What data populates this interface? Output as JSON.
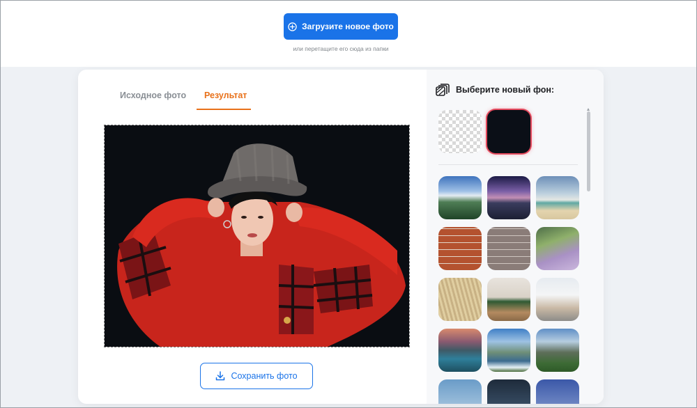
{
  "upload": {
    "button_label": "Загрузите новое фото",
    "hint": "или перетащите его сюда из папки",
    "icon": "plus-circle-icon"
  },
  "tabs": [
    {
      "label": "Исходное фото",
      "active": false
    },
    {
      "label": "Результат",
      "active": true
    }
  ],
  "result": {
    "image_description_icon": "person-photo",
    "save_label": "Сохранить фото",
    "save_icon": "download-icon"
  },
  "sidebar": {
    "title": "Выберите новый фон:",
    "title_icon": "layers-icon",
    "colors": {
      "selected_ring": "#e54a5e",
      "selected_fill": "#0b0f17",
      "accent_blue": "#1a73e8",
      "accent_orange": "#e8711a"
    },
    "backgrounds": [
      "mountains-lake",
      "night-sky-mountains",
      "beach",
      "red-brick-wall",
      "grey-brick-wall",
      "lavender-path",
      "wheat-field",
      "christmas-room",
      "living-room",
      "mountain-lake-sunset",
      "mountain-river",
      "green-peaks",
      "sky-1",
      "sky-2",
      "sky-3"
    ]
  }
}
